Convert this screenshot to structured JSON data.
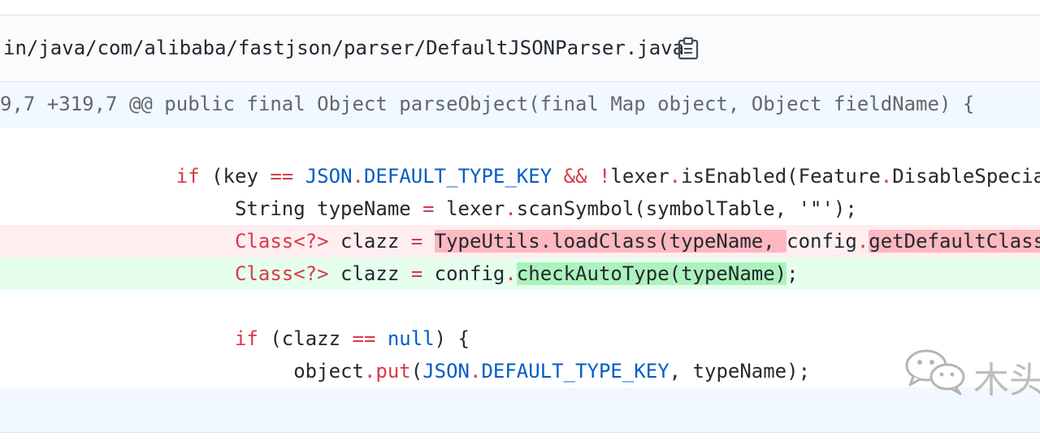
{
  "file": {
    "path": "in/java/com/alibaba/fastjson/parser/DefaultJSONParser.java",
    "copy_icon": "clipboard-icon"
  },
  "hunk": {
    "header": "9,7 +319,7 @@ public final Object parseObject(final Map object, Object fieldName) {"
  },
  "lines": {
    "l1": {
      "indent": "               ",
      "if": "if",
      "a": " (key ",
      "eq": "==",
      "b": " ",
      "json": "JSON",
      "dot1": ".",
      "key": "DEFAULT_TYPE_KEY",
      "c": " ",
      "and": "&&",
      "d": " ",
      "not": "!",
      "e": "lexer",
      "dot2": ".",
      "f": "isEnabled(Feature",
      "dot3": ".",
      "g": "DisableSpecialKeyDetect"
    },
    "l2": {
      "indent": "                    ",
      "a": "String typeName ",
      "eq": "=",
      "b": " lexer",
      "dot": ".",
      "c": "scanSymbol(symbolTable, '\"');"
    },
    "l3": {
      "indent": "                    ",
      "cls": "Class<?>",
      "a": " clazz ",
      "eq": "=",
      "b": " ",
      "hl1": "TypeUtils.loadClass(typeName, ",
      "c": "config",
      "dot": ".",
      "hl2": "getDefaultClassLoader());"
    },
    "l4": {
      "indent": "                    ",
      "cls": "Class<?>",
      "a": " clazz ",
      "eq": "=",
      "b": " config",
      "dot": ".",
      "hl": "checkAutoType(typeName)",
      "c": ";"
    },
    "l6": {
      "indent": "                    ",
      "if": "if",
      "a": " (clazz ",
      "eq": "==",
      "b": " ",
      "null": "null",
      "c": ") {"
    },
    "l7": {
      "indent": "                         ",
      "a": "object",
      "dot1": ".",
      "put": "put",
      "b": "(",
      "json": "JSON",
      "dot2": ".",
      "key": "DEFAULT_TYPE_KEY",
      "c": ", typeName);"
    }
  },
  "watermark": {
    "icon": "wechat-icon",
    "text": "木头"
  }
}
